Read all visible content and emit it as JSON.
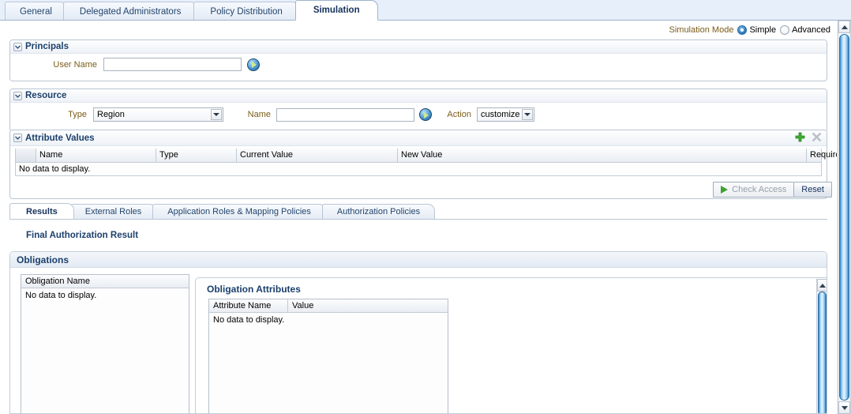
{
  "top_tabs": [
    {
      "label": "General",
      "active": false
    },
    {
      "label": "Delegated Administrators",
      "active": false
    },
    {
      "label": "Policy Distribution",
      "active": false
    },
    {
      "label": "Simulation",
      "active": true
    }
  ],
  "simulation_mode": {
    "label": "Simulation Mode",
    "options": [
      "Simple",
      "Advanced"
    ],
    "selected": "Simple"
  },
  "principals": {
    "title": "Principals",
    "user_name_label": "User Name",
    "user_name_value": "",
    "user_name_placeholder": "",
    "search_icon": "go-search-icon"
  },
  "resource": {
    "title": "Resource",
    "type_label": "Type",
    "type_value": "Region",
    "name_label": "Name",
    "name_value": "",
    "name_placeholder": "",
    "search_icon": "go-search-icon",
    "action_label": "Action",
    "action_value": "customize"
  },
  "attribute_values": {
    "title": "Attribute Values",
    "add_icon": "add-plus-icon",
    "delete_icon": "delete-x-icon",
    "columns": [
      "",
      "Name",
      "Type",
      "Current Value",
      "New Value",
      "Required"
    ],
    "empty_text": "No data to display."
  },
  "actions": {
    "check_access_label": "Check Access",
    "check_access_icon": "play-triangle-icon",
    "check_access_disabled": true,
    "reset_label": "Reset"
  },
  "result_tabs": [
    {
      "label": "Results",
      "active": true
    },
    {
      "label": "External Roles",
      "active": false
    },
    {
      "label": "Application Roles & Mapping Policies",
      "active": false
    },
    {
      "label": "Authorization Policies",
      "active": false
    }
  ],
  "results": {
    "heading": "Final Authorization Result"
  },
  "obligations": {
    "title": "Obligations",
    "list_header": "Obligation Name",
    "list_empty": "No data to display.",
    "attributes": {
      "title": "Obligation Attributes",
      "columns": [
        "Attribute Name",
        "Value"
      ],
      "empty_text": "No data to display."
    }
  },
  "colors": {
    "page_bg": "#e7effa",
    "panel_border": "#bac6d4",
    "heading_blue": "#1b3f6b",
    "label_brown": "#7a5c18",
    "accent_green": "#3fa030",
    "scroll_blue": "#2f7fc4"
  }
}
